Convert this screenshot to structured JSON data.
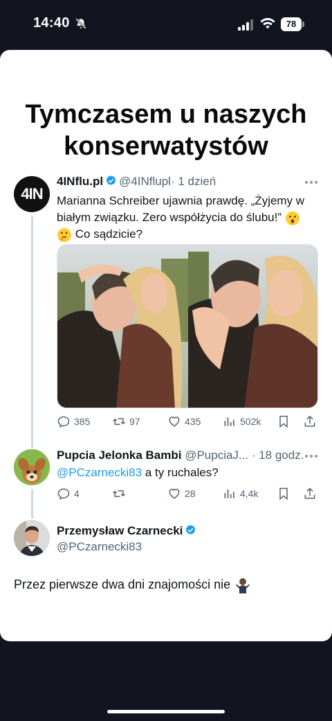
{
  "status_bar": {
    "time": "14:40",
    "battery": "78"
  },
  "headline": {
    "line1": "Tymczasem u naszych",
    "line2": "konserwatystów"
  },
  "tweet1": {
    "avatar_text": "4IN",
    "name": "4INflu.pl",
    "handle": "@4INflupl",
    "time": "· 1 dzień",
    "text_line1": "Marianna Schreiber ujawnia prawdę. „Żyjemy w",
    "text_line2": "białym związku. Zero współżycia do ślubu!”",
    "text_line3": "Co sądzicie?",
    "replies": "385",
    "reposts": "97",
    "likes": "435",
    "views": "502k"
  },
  "tweet2": {
    "name": "Pupcia Jelonka Bambi",
    "handle": "@PupciaJ...",
    "time": "· 18 godz.",
    "mention": "@PCzarnecki83",
    "text": " a ty ruchales?",
    "replies": "4",
    "reposts": "",
    "likes": "28",
    "views": "4,4k"
  },
  "tweet3": {
    "name": "Przemysław Czarnecki",
    "handle": "@PCzarnecki83",
    "text": "Przez pierwsze dwa dni znajomości nie"
  },
  "colors": {
    "accent": "#1d9bf0",
    "text": "#0f1419",
    "muted": "#536471",
    "background": "#12151f"
  }
}
